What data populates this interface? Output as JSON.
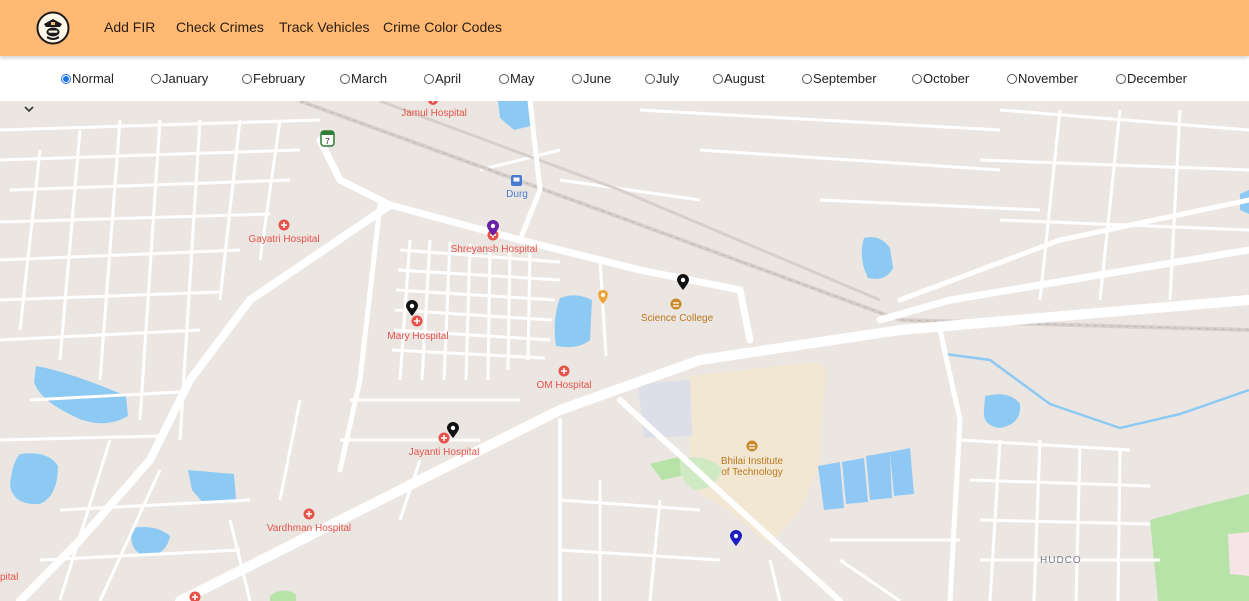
{
  "nav": {
    "links": [
      "Add FIR",
      "Check Crimes",
      "Track Vehicles",
      "Crime Color Codes"
    ]
  },
  "filter": {
    "selected": "Normal",
    "options": [
      "Normal",
      "January",
      "February",
      "March",
      "April",
      "May",
      "June",
      "July",
      "August",
      "September",
      "October",
      "November",
      "December"
    ]
  },
  "map": {
    "places": {
      "jamul": "Jamul Hospital",
      "durg": "Durg",
      "gayatri": "Gayatri Hospital",
      "shreyansh": "Shreyansh Hospital",
      "mary": "Mary Hospital",
      "science": "Science College",
      "om": "OM Hospital",
      "jayanti": "Jayanti Hospital",
      "bit1": "Bhilai Institute",
      "bit2": "of Technology",
      "vardhman": "Vardhman Hospital",
      "hudco": "HUDCO",
      "edge": "pital",
      "route": "7"
    },
    "marker_colors": {
      "crime": "#111111",
      "purple": "#6a1fa8",
      "blue": "#1d1dbf"
    },
    "colors": {
      "land": "#ece6e2",
      "road": "#ffffff",
      "water": "#8ccaf3",
      "park": "#b7e3a8",
      "campus": "#f2e7d3",
      "hospital": "#e5534b"
    }
  }
}
